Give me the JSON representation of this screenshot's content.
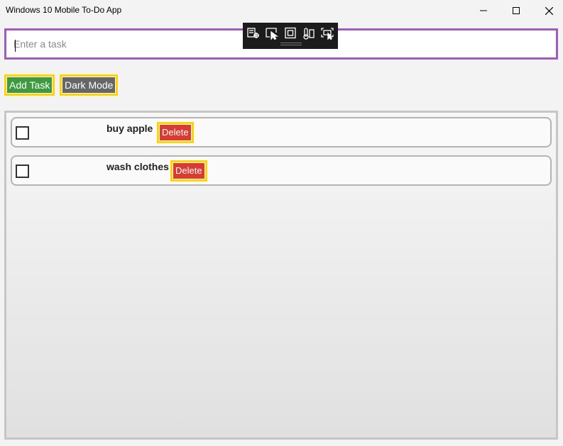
{
  "window": {
    "title": "Windows 10 Mobile To-Do App"
  },
  "task_input": {
    "placeholder": "Enter a task",
    "value": ""
  },
  "toolbar": {
    "add_label": "Add Task",
    "dark_label": "Dark Mode"
  },
  "tasks": [
    {
      "text": "buy apple",
      "done": false,
      "delete_label": "Delete"
    },
    {
      "text": "wash clothes",
      "done": false,
      "delete_label": "Delete"
    }
  ],
  "colors": {
    "input_border": "#a05ac0",
    "focus_highlight": "#ffd400",
    "add_button": "#3e9a3e",
    "dark_button": "#666666",
    "delete_button": "#d93a32"
  },
  "icons": {
    "minimize": "minimize-icon",
    "maximize": "maximize-icon",
    "close": "close-icon",
    "debug_tools": [
      "live-visual-tree-icon",
      "select-element-icon",
      "display-layout-adorners-icon",
      "track-focus-icon",
      "hot-reload-icon"
    ]
  }
}
